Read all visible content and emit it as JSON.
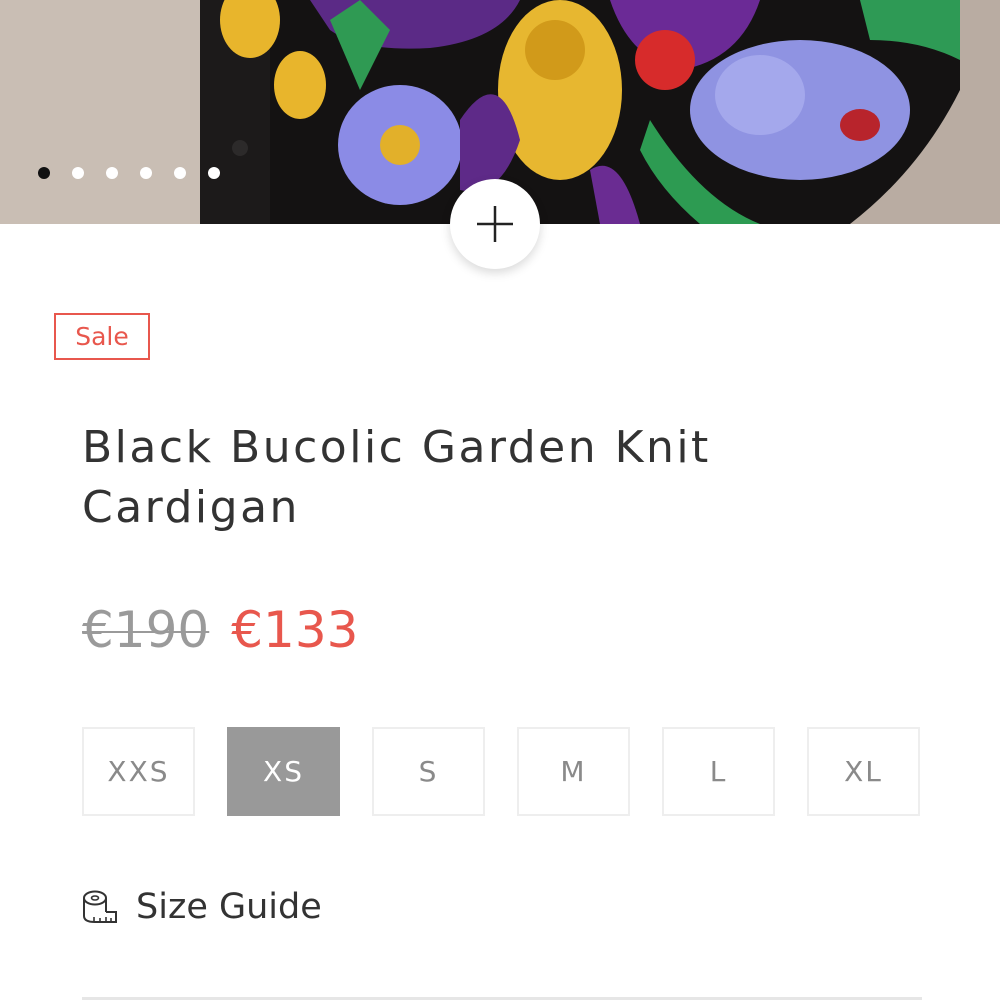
{
  "gallery": {
    "slide_count": 6,
    "active_slide": 1,
    "zoom_icon": "plus-icon"
  },
  "product": {
    "badge": "Sale",
    "title": "Black Bucolic Garden Knit Cardigan",
    "price_original": "€190",
    "price_sale": "€133",
    "sizes": [
      "XXS",
      "XS",
      "S",
      "M",
      "L",
      "XL"
    ],
    "selected_size": "XS",
    "size_guide_label": "Size Guide",
    "size_guide_icon": "tape-measure-icon"
  },
  "colors": {
    "sale_accent": "#e8574d",
    "selected_size_bg": "#999999",
    "text": "#333333",
    "old_price": "#9a9a9a"
  }
}
